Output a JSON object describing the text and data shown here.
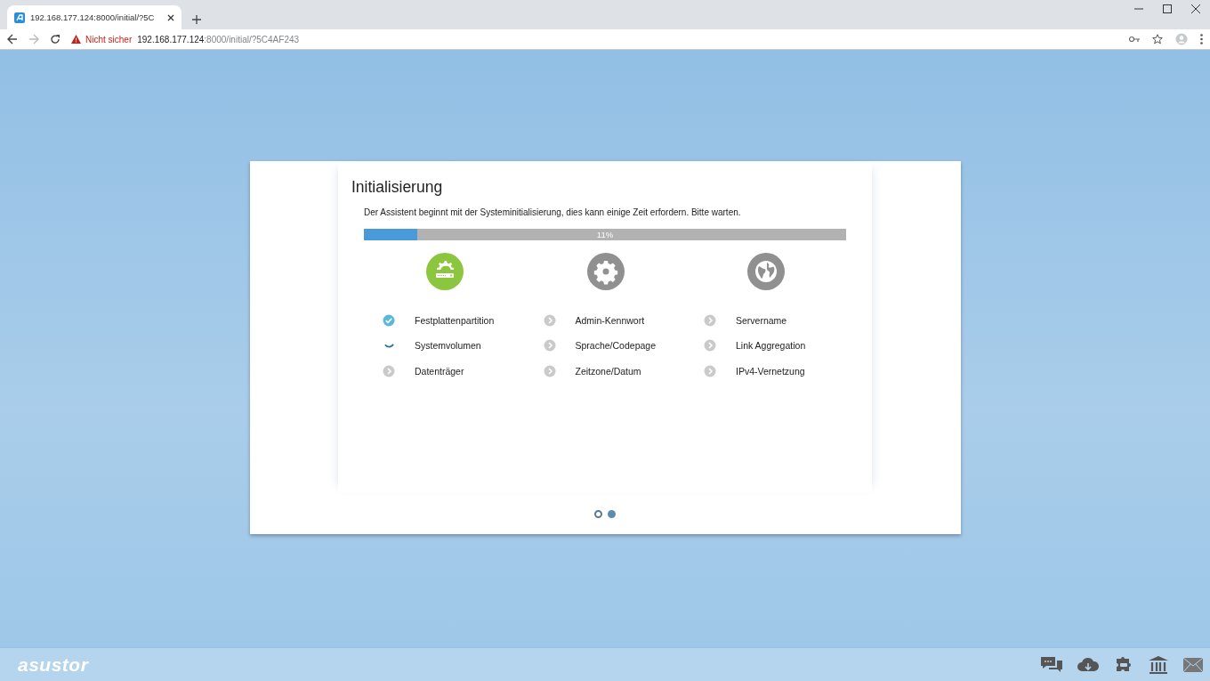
{
  "browser": {
    "tab_title": "192.168.177.124:8000/initial/?5C",
    "security": "Nicht sicher",
    "url_host": "192.168.177.124",
    "url_path": ":8000/initial/?5C4AF243"
  },
  "wizard": {
    "title": "Initialisierung",
    "description": "Der Assistent beginnt mit der Systeminitialisierung, dies kann einige Zeit erfordern. Bitte warten.",
    "progress": {
      "level": 0.11,
      "label": "11%"
    },
    "columns": [
      {
        "kind": "storage",
        "active": true,
        "steps": [
          {
            "label": "Festplattenpartition",
            "kind": "done"
          },
          {
            "label": "Systemvolumen",
            "kind": "running"
          },
          {
            "label": "Datenträger",
            "kind": "pending"
          }
        ]
      },
      {
        "kind": "system",
        "active": false,
        "steps": [
          {
            "label": "Admin-Kennwort",
            "kind": "pending"
          },
          {
            "label": "Sprache/Codepage",
            "kind": "pending"
          },
          {
            "label": "Zeitzone/Datum",
            "kind": "pending"
          }
        ]
      },
      {
        "kind": "network",
        "active": false,
        "steps": [
          {
            "label": "Servername",
            "kind": "pending"
          },
          {
            "label": "Link Aggregation",
            "kind": "pending"
          },
          {
            "label": "IPv4-Vernetzung",
            "kind": "pending"
          }
        ]
      }
    ],
    "pages": [
      {
        "selected": false
      },
      {
        "selected": true
      }
    ]
  },
  "footer": {
    "logo": "asustor"
  }
}
